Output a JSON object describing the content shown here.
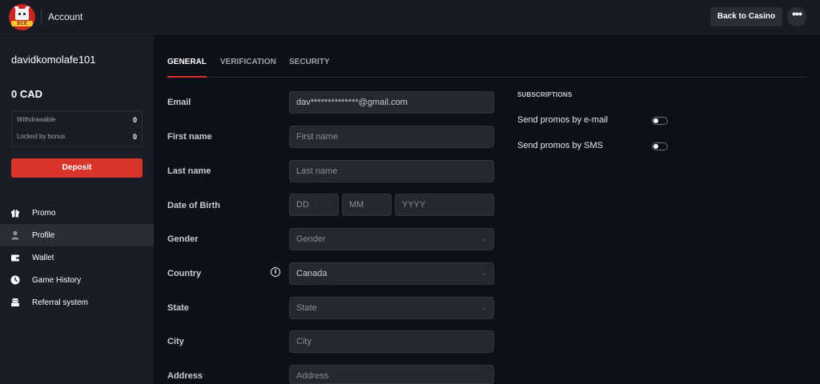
{
  "header": {
    "logo_text": "ECE",
    "title": "Account",
    "back_button": "Back to Casino",
    "more_icon": "more-horizontal-icon",
    "more_glyph": "•••"
  },
  "sidebar": {
    "username": "davidkomolafe101",
    "balance": "0 CAD",
    "withdrawable_label": "Withdrawable",
    "withdrawable_value": "0",
    "locked_label": "Locked by bonus",
    "locked_value": "0",
    "deposit_button": "Deposit",
    "nav": [
      {
        "label": "Promo",
        "icon": "gift-icon"
      },
      {
        "label": "Profile",
        "icon": "user-icon",
        "active": true
      },
      {
        "label": "Wallet",
        "icon": "wallet-icon"
      },
      {
        "label": "Game History",
        "icon": "clock-icon"
      },
      {
        "label": "Referral system",
        "icon": "referral-icon"
      }
    ]
  },
  "tabs": [
    {
      "label": "GENERAL",
      "active": true
    },
    {
      "label": "VERIFICATION"
    },
    {
      "label": "SECURITY"
    }
  ],
  "form": {
    "email": {
      "label": "Email",
      "value": "dav**************@gmail.com"
    },
    "first_name": {
      "label": "First name",
      "placeholder": "First name"
    },
    "last_name": {
      "label": "Last name",
      "placeholder": "Last name"
    },
    "dob": {
      "label": "Date of Birth",
      "day": "DD",
      "month": "MM",
      "year": "YYYY"
    },
    "gender": {
      "label": "Gender",
      "placeholder": "Gender"
    },
    "country": {
      "label": "Country",
      "value": "Canada",
      "info_icon": "info-icon",
      "info_glyph": "i"
    },
    "state": {
      "label": "State",
      "placeholder": "State"
    },
    "city": {
      "label": "City",
      "placeholder": "City"
    },
    "address": {
      "label": "Address",
      "placeholder": "Address"
    }
  },
  "subscriptions": {
    "title": "SUBSCRIPTIONS",
    "email_promos": {
      "label": "Send promos by e-mail",
      "enabled": false
    },
    "sms_promos": {
      "label": "Send promos by SMS",
      "enabled": false
    }
  },
  "colors": {
    "accent": "#d9342a",
    "background": "#0d1017",
    "sidebar": "#1a1d25",
    "field": "#252832"
  }
}
